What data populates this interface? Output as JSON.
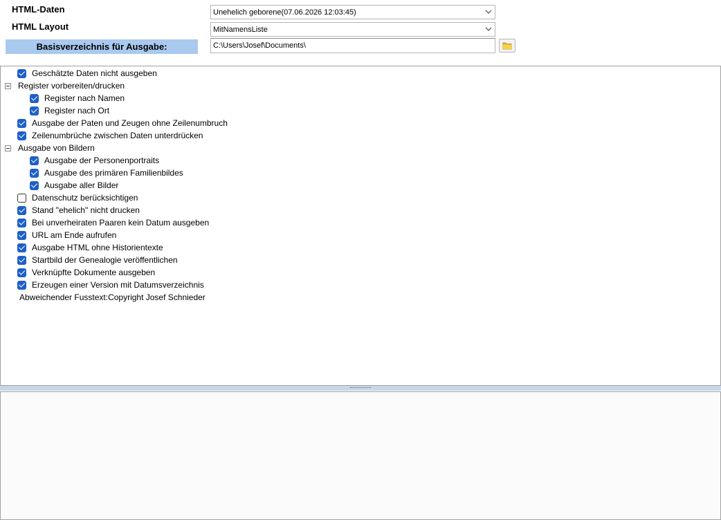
{
  "header": {
    "html_daten_label": "HTML-Daten",
    "html_layout_label": "HTML Layout",
    "basis_label": "Basisverzeichnis  für Ausgabe:",
    "html_daten_value": "Unehelich geborene(07.06.2026 12:03:45)",
    "html_layout_value": "MitNamensListe",
    "basis_path": "C:\\Users\\Josef\\Documents\\"
  },
  "options": {
    "geschaetzte": {
      "label": "Geschätzte Daten nicht ausgeben",
      "checked": true
    },
    "register_group": {
      "label": "Register vorbereiten/drucken",
      "expanded": true
    },
    "register_namen": {
      "label": "Register nach Namen",
      "checked": true
    },
    "register_ort": {
      "label": "Register nach Ort",
      "checked": true
    },
    "paten": {
      "label": "Ausgabe der Paten und Zeugen ohne Zeilenumbruch",
      "checked": true
    },
    "zeilenumbrueche": {
      "label": "Zeilenumbrüche zwischen Daten unterdrücken",
      "checked": true
    },
    "bilder_group": {
      "label": "Ausgabe von Bildern",
      "expanded": true
    },
    "personenportraits": {
      "label": "Ausgabe der Personenportraits",
      "checked": true
    },
    "familienbild": {
      "label": "Ausgabe des primären Familienbildes",
      "checked": true
    },
    "alle_bilder": {
      "label": "Ausgabe aller Bilder",
      "checked": true
    },
    "datenschutz": {
      "label": "Datenschutz berücksichtigen",
      "checked": false
    },
    "ehelich": {
      "label": "Stand \"ehelich\" nicht drucken",
      "checked": true
    },
    "unverheiratet": {
      "label": "Bei unverheiraten Paaren kein Datum ausgeben",
      "checked": true
    },
    "url_ende": {
      "label": "URL am Ende aufrufen",
      "checked": true
    },
    "historientexte": {
      "label": "Ausgabe HTML ohne Historientexte",
      "checked": true
    },
    "startbild": {
      "label": "Startbild der Genealogie veröffentlichen",
      "checked": true
    },
    "dokumente": {
      "label": "Verknüpfte Dokumente ausgeben",
      "checked": true
    },
    "datumsverzeichnis": {
      "label": "Erzeugen einer Version mit Datumsverzeichnis",
      "checked": true
    },
    "fusstext": "Abweichender Fusstext:Copyright Josef Schnieder"
  },
  "icons": {
    "dropdown": "chevron-down-icon",
    "folder": "folder-icon",
    "checkbox_checked": "checkmark",
    "tree_expanded": "minus-box"
  },
  "colors": {
    "checkbox_blue": "#1e60c8",
    "basis_label_bg": "#a9c9ef",
    "splitter": "#c7d7ea"
  }
}
